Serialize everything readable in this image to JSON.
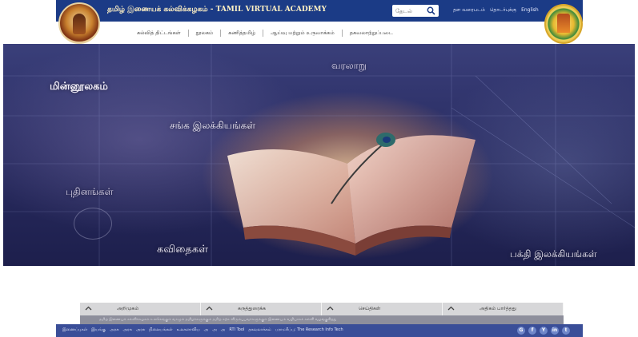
{
  "header": {
    "title": "தமிழ் இணையக் கல்விக்கழகம் - TAMIL VIRTUAL ACADEMY",
    "search_placeholder": "தேடல்",
    "top_links": [
      "தள வரைபடம்",
      "தொடர்புக்கு",
      "English"
    ]
  },
  "nav": {
    "items": [
      "கல்வித் திட்டங்கள்",
      "நூலகம்",
      "கணித்தமிழ்",
      "ஆய்வு மற்றும் உருவாக்கம்",
      "தகவலாற்றுப்படை"
    ]
  },
  "hero": {
    "labels": {
      "ebooks": "மின்னூலகம்",
      "history": "வரலாறு",
      "sangam": "சங்க இலக்கியங்கள்",
      "novels": "புதினங்கள்",
      "poems": "கவிதைகள்",
      "bhakti": "பக்தி இலக்கியங்கள்"
    }
  },
  "bottom_tabs": [
    "அறிமுகம்",
    "கருத்துரைக்க",
    "செய்திகள்",
    "அதிகம் பார்த்தது"
  ],
  "ticker": "தமிழ் இணையக் கல்விக்கழகம் உலகெங்கும் வாழும் தமிழர்களுக்கும் தமிழ் கற்க விரும்புபவர்களுக்கும் இணையம் வழியாகக் கல்வி வழங்குகிறது",
  "footer": {
    "links": [
      "இணைப்புகள்",
      "இயங்கு",
      "அரசு",
      "அரசு",
      "அரசு",
      "நிலையங்கள்",
      "உலகளாவிய",
      "அ",
      "அ",
      "அ",
      "RTI Tool",
      "தகவலாக்கம்",
      "பராமரிப்பு: The Research Info Tech"
    ],
    "social": [
      "G",
      "f",
      "Y",
      "in",
      "t"
    ]
  },
  "colors": {
    "header_bg": "#1b3b86",
    "footer_bg": "#3a4e98",
    "hero_bg": "#2a2d63"
  }
}
